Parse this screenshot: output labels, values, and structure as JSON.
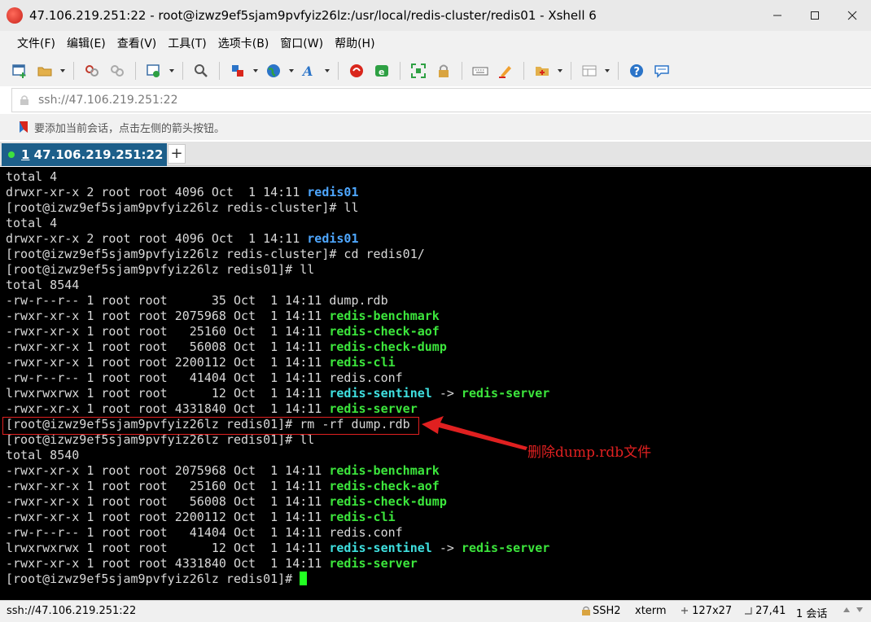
{
  "window": {
    "title": "47.106.219.251:22 - root@izwz9ef5sjam9pvfyiz26lz:/usr/local/redis-cluster/redis01 - Xshell 6"
  },
  "menu": {
    "items": [
      {
        "label": "文件(F)"
      },
      {
        "label": "编辑(E)"
      },
      {
        "label": "查看(V)"
      },
      {
        "label": "工具(T)"
      },
      {
        "label": "选项卡(B)"
      },
      {
        "label": "窗口(W)"
      },
      {
        "label": "帮助(H)"
      }
    ]
  },
  "toolbar": {
    "icons": [
      "new-session-icon",
      "open-folder-icon",
      "reconnect-icon",
      "disconnect-icon",
      "properties-icon",
      "find-icon",
      "transfer-icon",
      "globe-icon",
      "font-icon",
      "xftp-icon",
      "xshell-green-icon",
      "fullscreen-icon",
      "lock-icon",
      "keyboard-icon",
      "highlight-icon",
      "compose-icon",
      "layout-icon",
      "help-icon",
      "chat-icon"
    ],
    "accent_colors": {
      "red": "#d9261c",
      "green": "#2ea043",
      "blue": "#2b74c8"
    }
  },
  "address": {
    "value": "ssh://47.106.219.251:22"
  },
  "hint": {
    "text": "要添加当前会话，点击左侧的箭头按钮。"
  },
  "tabs": {
    "active": {
      "number": "1",
      "label": " 47.106.219.251:22"
    },
    "add_label": "+"
  },
  "terminal": {
    "colors": {
      "background": "#000000",
      "text": "#d8d8d8",
      "directory": "#4ea7ff",
      "executable": "#3ce63c",
      "symlink": "#3fe0e0",
      "cursor": "#22ff22"
    },
    "lines": [
      [
        {
          "t": "total 4"
        }
      ],
      [
        {
          "t": "drwxr-xr-x 2 root root 4096 Oct  1 14:11 "
        },
        {
          "t": "redis01",
          "c": "blue"
        }
      ],
      [
        {
          "t": "[root@izwz9ef5sjam9pvfyiz26lz redis-cluster]# ll"
        }
      ],
      [
        {
          "t": "total 4"
        }
      ],
      [
        {
          "t": "drwxr-xr-x 2 root root 4096 Oct  1 14:11 "
        },
        {
          "t": "redis01",
          "c": "blue"
        }
      ],
      [
        {
          "t": "[root@izwz9ef5sjam9pvfyiz26lz redis-cluster]# cd redis01/"
        }
      ],
      [
        {
          "t": "[root@izwz9ef5sjam9pvfyiz26lz redis01]# ll"
        }
      ],
      [
        {
          "t": "total 8544"
        }
      ],
      [
        {
          "t": "-rw-r--r-- 1 root root      35 Oct  1 14:11 dump.rdb"
        }
      ],
      [
        {
          "t": "-rwxr-xr-x 1 root root 2075968 Oct  1 14:11 "
        },
        {
          "t": "redis-benchmark",
          "c": "green"
        }
      ],
      [
        {
          "t": "-rwxr-xr-x 1 root root   25160 Oct  1 14:11 "
        },
        {
          "t": "redis-check-aof",
          "c": "green"
        }
      ],
      [
        {
          "t": "-rwxr-xr-x 1 root root   56008 Oct  1 14:11 "
        },
        {
          "t": "redis-check-dump",
          "c": "green"
        }
      ],
      [
        {
          "t": "-rwxr-xr-x 1 root root 2200112 Oct  1 14:11 "
        },
        {
          "t": "redis-cli",
          "c": "green"
        }
      ],
      [
        {
          "t": "-rw-r--r-- 1 root root   41404 Oct  1 14:11 redis.conf"
        }
      ],
      [
        {
          "t": "lrwxrwxrwx 1 root root      12 Oct  1 14:11 "
        },
        {
          "t": "redis-sentinel",
          "c": "cyan"
        },
        {
          "t": " -> "
        },
        {
          "t": "redis-server",
          "c": "green"
        }
      ],
      [
        {
          "t": "-rwxr-xr-x 1 root root 4331840 Oct  1 14:11 "
        },
        {
          "t": "redis-server",
          "c": "green"
        }
      ],
      [
        {
          "t": "[root@izwz9ef5sjam9pvfyiz26lz redis01]# rm -rf dump.rdb"
        }
      ],
      [
        {
          "t": "[root@izwz9ef5sjam9pvfyiz26lz redis01]# ll"
        }
      ],
      [
        {
          "t": "total 8540"
        }
      ],
      [
        {
          "t": "-rwxr-xr-x 1 root root 2075968 Oct  1 14:11 "
        },
        {
          "t": "redis-benchmark",
          "c": "green"
        }
      ],
      [
        {
          "t": "-rwxr-xr-x 1 root root   25160 Oct  1 14:11 "
        },
        {
          "t": "redis-check-aof",
          "c": "green"
        }
      ],
      [
        {
          "t": "-rwxr-xr-x 1 root root   56008 Oct  1 14:11 "
        },
        {
          "t": "redis-check-dump",
          "c": "green"
        }
      ],
      [
        {
          "t": "-rwxr-xr-x 1 root root 2200112 Oct  1 14:11 "
        },
        {
          "t": "redis-cli",
          "c": "green"
        }
      ],
      [
        {
          "t": "-rw-r--r-- 1 root root   41404 Oct  1 14:11 redis.conf"
        }
      ],
      [
        {
          "t": "lrwxrwxrwx 1 root root      12 Oct  1 14:11 "
        },
        {
          "t": "redis-sentinel",
          "c": "cyan"
        },
        {
          "t": " -> "
        },
        {
          "t": "redis-server",
          "c": "green"
        }
      ],
      [
        {
          "t": "-rwxr-xr-x 1 root root 4331840 Oct  1 14:11 "
        },
        {
          "t": "redis-server",
          "c": "green"
        }
      ],
      [
        {
          "t": "[root@izwz9ef5sjam9pvfyiz26lz redis01]# "
        },
        {
          "t": "",
          "c": "cursor"
        }
      ]
    ],
    "annotation": {
      "text": "删除dump.rdb文件",
      "color": "#e02020"
    }
  },
  "status": {
    "address": "ssh://47.106.219.251:22",
    "protocol": "SSH2",
    "terminal_type": "xterm",
    "size": "127x27",
    "position": "27,41",
    "sessions": "1 会话"
  }
}
